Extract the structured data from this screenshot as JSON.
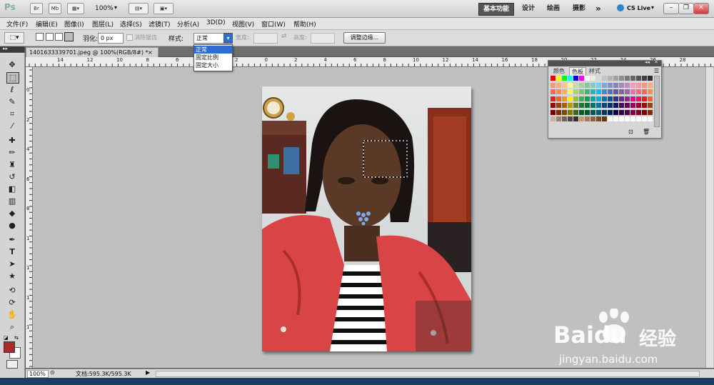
{
  "appbar": {
    "logo": "Ps",
    "bridge": "Br",
    "minibridge": "Mb",
    "zoom": "100%",
    "workspaces": [
      "基本功能",
      "设计",
      "绘画",
      "摄影"
    ],
    "more": "»",
    "cslive": "CS Live"
  },
  "menus": [
    "文件(F)",
    "编辑(E)",
    "图像(I)",
    "图层(L)",
    "选择(S)",
    "滤镜(T)",
    "分析(A)",
    "3D(D)",
    "视图(V)",
    "窗口(W)",
    "帮助(H)"
  ],
  "options": {
    "feather_label": "羽化:",
    "feather_value": "0 px",
    "antialias_label": "消除锯齿",
    "style_label": "样式:",
    "style_value": "正常",
    "width_label": "宽度:",
    "height_label": "高度:",
    "refine_edge_label": "调整边缘..."
  },
  "style_dropdown": {
    "options": [
      "正常",
      "固定比例",
      "固定大小"
    ],
    "selected_index": 0
  },
  "document": {
    "tab_title": "1401633339701.jpeg @ 100%(RGB/8#) *",
    "close": "×"
  },
  "rulers": {
    "h_labels": [
      "14",
      "12",
      "10",
      "8",
      "6",
      "4",
      "2",
      "0",
      "2",
      "4",
      "6",
      "8",
      "10",
      "12",
      "14",
      "16",
      "18",
      "20",
      "22",
      "24",
      "26",
      "28"
    ],
    "v_labels": [
      "0",
      "2",
      "4",
      "6",
      "8",
      "1",
      "1",
      "1",
      "1"
    ]
  },
  "status": {
    "zoom": "100%",
    "doc_size": "文档:595.3K/595.3K"
  },
  "swatches_panel": {
    "tabs": [
      "颜色",
      "色板",
      "样式"
    ],
    "active_tab": "色板"
  },
  "colors": {
    "foreground": "#a62b2b",
    "background": "#ffffff",
    "jacket": "#d94446",
    "skin": "#5a3a26"
  },
  "watermark": {
    "brand": "Bai",
    "brand2": "du",
    "cn": "经验",
    "url": "jingyan.baidu.com"
  }
}
